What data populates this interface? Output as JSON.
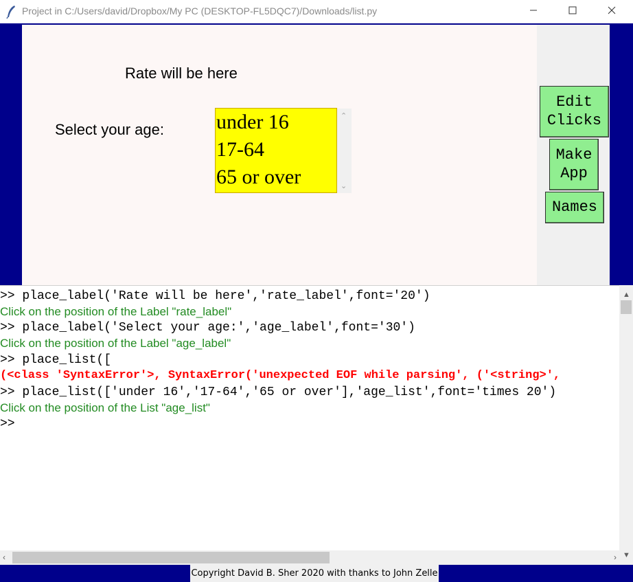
{
  "window": {
    "title": "Project in C:/Users/david/Dropbox/My PC (DESKTOP-FL5DQC7)/Downloads/list.py",
    "icon": "feather-icon",
    "controls": [
      "minimize-icon",
      "maximize-icon",
      "close-icon"
    ]
  },
  "canvas": {
    "rate_label": "Rate will be here",
    "age_label": "Select your age:",
    "age_list": [
      "under 16",
      "17-64",
      "65 or over"
    ],
    "list_background": "#ffff00"
  },
  "sidebar": {
    "edit_clicks": [
      "Edit",
      "Clicks"
    ],
    "make_app": [
      "Make",
      "App"
    ],
    "names": "Names",
    "button_color": "#90ee90"
  },
  "console": {
    "lines": [
      {
        "type": "cmd",
        "text": ">> place_label('Rate will be here','rate_label',font='20')"
      },
      {
        "type": "msg",
        "text": "Click on the position of the Label \"rate_label\""
      },
      {
        "type": "cmd",
        "text": ">> place_label('Select your age:','age_label',font='30')"
      },
      {
        "type": "msg",
        "text": "Click on the position of the Label \"age_label\""
      },
      {
        "type": "cmd",
        "text": ">> place_list(["
      },
      {
        "type": "err",
        "text": "(<class 'SyntaxError'>, SyntaxError('unexpected EOF while parsing', ('<string>',"
      },
      {
        "type": "cmd",
        "text": ">> place_list(['under 16','17-64','65 or over'],'age_list',font='times 20')"
      },
      {
        "type": "msg",
        "text": "Click on the position of the List \"age_list\""
      },
      {
        "type": "cmd",
        "text": ">>"
      }
    ],
    "prompt_color": "#000000",
    "message_color": "#228b22",
    "error_color": "#ff0000"
  },
  "footer": {
    "copyright": "Copyright David B. Sher 2020 with thanks to John Zelle",
    "background": "#00008b"
  }
}
